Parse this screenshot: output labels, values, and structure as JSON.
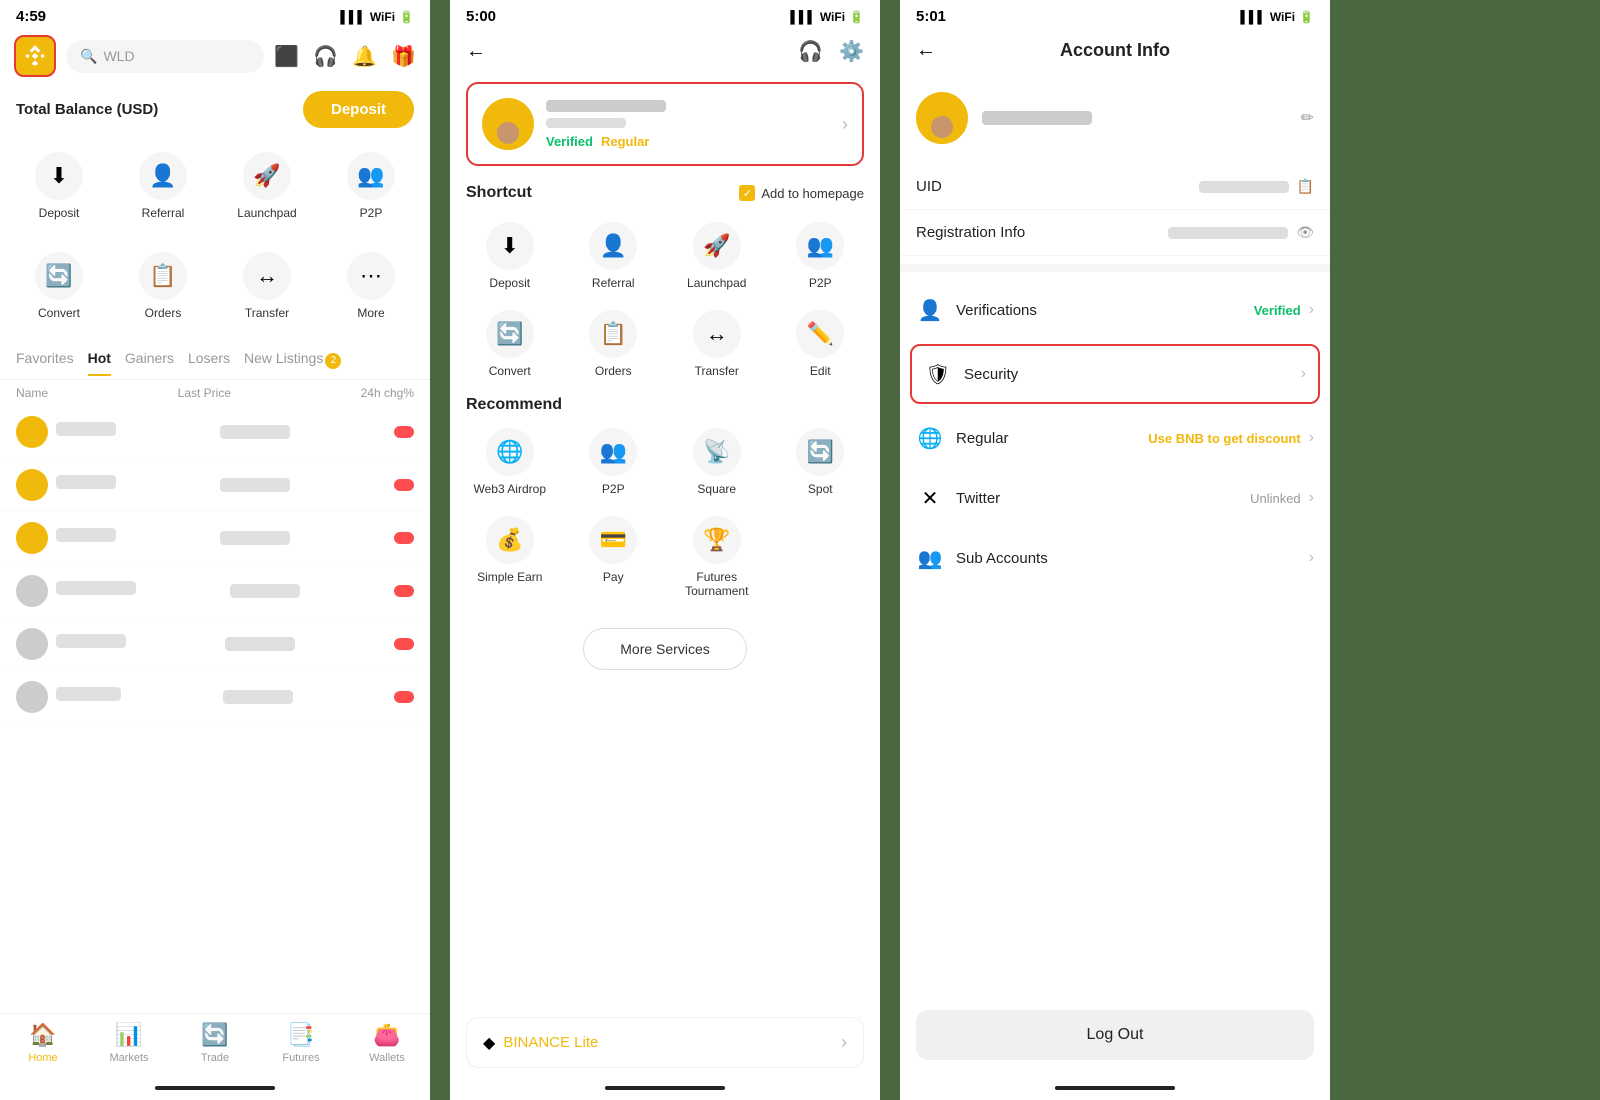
{
  "screen1": {
    "status_time": "4:59",
    "logo_alt": "Binance Logo",
    "search_placeholder": "WLD",
    "balance_label": "Total Balance (USD)",
    "deposit_btn": "Deposit",
    "quick_actions": [
      {
        "label": "Deposit",
        "icon": "⬇"
      },
      {
        "label": "Referral",
        "icon": "👤"
      },
      {
        "label": "Launchpad",
        "icon": "🚀"
      },
      {
        "label": "P2P",
        "icon": "👥"
      }
    ],
    "quick_actions2": [
      {
        "label": "Convert",
        "icon": "🔄"
      },
      {
        "label": "Orders",
        "icon": "📋"
      },
      {
        "label": "Transfer",
        "icon": "↔"
      },
      {
        "label": "More",
        "icon": "⋯"
      }
    ],
    "tabs": [
      {
        "label": "Favorites",
        "active": false
      },
      {
        "label": "Hot",
        "active": true
      },
      {
        "label": "Gainers",
        "active": false
      },
      {
        "label": "Losers",
        "active": false
      },
      {
        "label": "New Listings",
        "active": false,
        "badge": "2"
      }
    ],
    "market_headers": [
      "Name",
      "Last Price",
      "24h chg%"
    ],
    "nav_items": [
      {
        "label": "Home",
        "icon": "🏠",
        "active": true
      },
      {
        "label": "Markets",
        "icon": "📊",
        "active": false
      },
      {
        "label": "Trade",
        "icon": "🔄",
        "active": false
      },
      {
        "label": "Futures",
        "icon": "📑",
        "active": false
      },
      {
        "label": "Wallets",
        "icon": "👛",
        "active": false
      }
    ]
  },
  "screen2": {
    "status_time": "5:00",
    "profile_verified": "Verified",
    "profile_regular": "Regular",
    "shortcut_title": "Shortcut",
    "add_homepage": "Add to homepage",
    "shortcuts": [
      {
        "label": "Deposit",
        "icon": "⬇"
      },
      {
        "label": "Referral",
        "icon": "👤"
      },
      {
        "label": "Launchpad",
        "icon": "🚀"
      },
      {
        "label": "P2P",
        "icon": "👥"
      },
      {
        "label": "Convert",
        "icon": "🔄"
      },
      {
        "label": "Orders",
        "icon": "📋"
      },
      {
        "label": "Transfer",
        "icon": "↔"
      },
      {
        "label": "Edit",
        "icon": "✏️"
      }
    ],
    "recommend_title": "Recommend",
    "recommend_items": [
      {
        "label": "Web3 Airdrop",
        "icon": "🌐"
      },
      {
        "label": "P2P",
        "icon": "👥"
      },
      {
        "label": "Square",
        "icon": "📡"
      },
      {
        "label": "Spot",
        "icon": "🔄"
      },
      {
        "label": "Simple Earn",
        "icon": "💰"
      },
      {
        "label": "Pay",
        "icon": "💳"
      },
      {
        "label": "Futures Tournament",
        "icon": "🏆"
      }
    ],
    "more_services_btn": "More Services",
    "binance_lite": "BINANCE",
    "binance_lite_suffix": " Lite"
  },
  "screen3": {
    "status_time": "5:01",
    "page_title": "Account Info",
    "uid_label": "UID",
    "reg_info_label": "Registration Info",
    "verifications_label": "Verifications",
    "verifications_status": "Verified",
    "security_label": "Security",
    "regular_label": "Regular",
    "regular_value": "Use BNB to get discount",
    "twitter_label": "Twitter",
    "twitter_value": "Unlinked",
    "sub_accounts_label": "Sub Accounts",
    "logout_btn": "Log Out"
  }
}
